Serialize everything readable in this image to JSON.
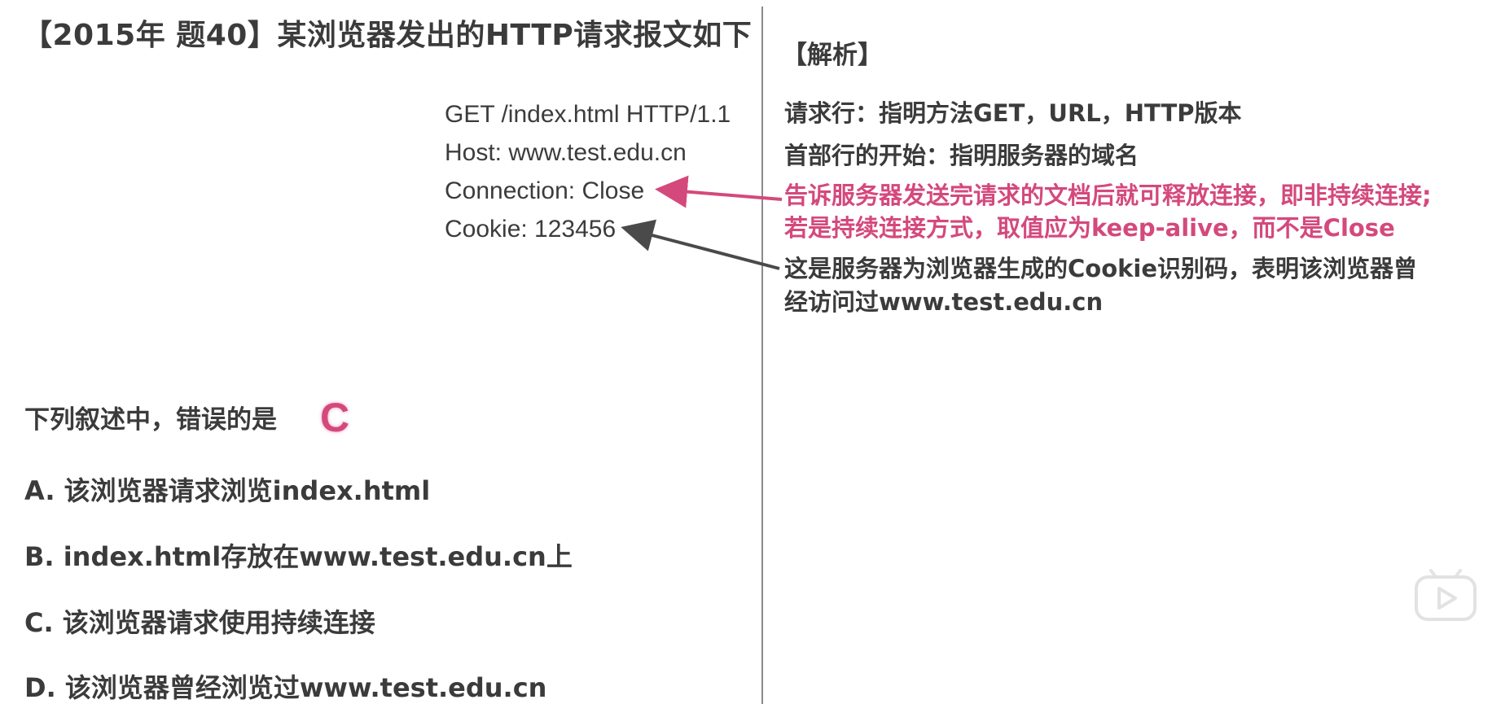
{
  "question_title": "【2015年 题40】某浏览器发出的HTTP请求报文如下",
  "http_request": {
    "lines": [
      "GET /index.html HTTP/1.1",
      "Host: www.test.edu.cn",
      "Connection: Close",
      "Cookie: 123456"
    ]
  },
  "question": {
    "prompt": "下列叙述中，错误的是",
    "answer": "C"
  },
  "options": [
    "A. 该浏览器请求浏览index.html",
    "B. index.html存放在www.test.edu.cn上",
    "C. 该浏览器请求使用持续连接",
    "D. 该浏览器曾经浏览过www.test.edu.cn"
  ],
  "analysis": {
    "title": "【解析】",
    "request_line_note": "请求行：指明方法GET，URL，HTTP版本",
    "header_start_note": "首部行的开始：指明服务器的域名",
    "connection_note": [
      "告诉服务器发送完请求的文档后就可释放连接，即非持续连接;",
      "若是持续连接方式，取值应为keep-alive，而不是Close"
    ],
    "cookie_note": [
      "这是服务器为浏览器生成的Cookie识别码，表明该浏览器曾",
      "经访问过www.test.edu.cn"
    ]
  },
  "colors": {
    "text": "#3b3b3b",
    "highlight": "#d4497c",
    "divider": "#8a8a8a",
    "arrow_dark": "#4a4a4a"
  },
  "icons": {
    "player": "play-button-icon"
  }
}
